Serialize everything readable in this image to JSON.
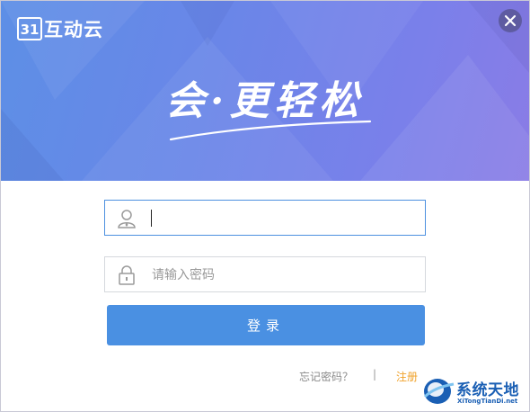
{
  "app": {
    "logo_mark": "31",
    "logo_text": "互动云"
  },
  "banner": {
    "slogan": "会·更轻松"
  },
  "form": {
    "username": {
      "value": "",
      "placeholder": ""
    },
    "password": {
      "value": "",
      "placeholder": "请输入密码"
    },
    "login_label": "登录"
  },
  "links": {
    "forgot": "忘记密码？",
    "separator": "|",
    "register": "注册"
  },
  "watermark": {
    "title": "系统天地",
    "url": "XiTongTianDi.net"
  },
  "colors": {
    "primary": "#4a90e2",
    "register": "#f0a22a",
    "banner_start": "#5d8fe6",
    "banner_end": "#8a7ce6"
  },
  "icons": {
    "close": "close-icon",
    "user": "user-icon",
    "lock": "lock-icon"
  }
}
